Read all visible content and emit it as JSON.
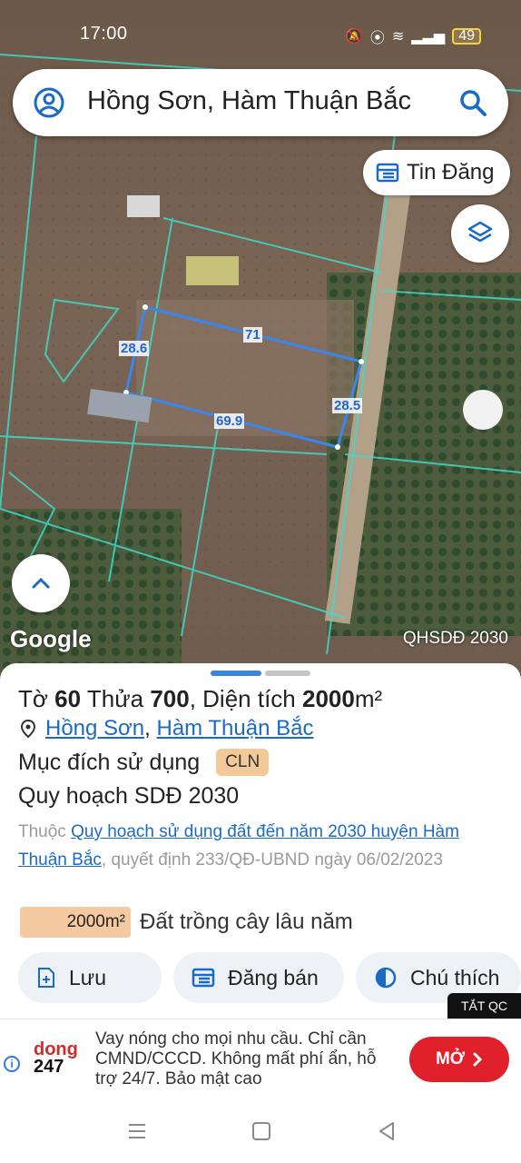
{
  "status_bar": {
    "time": "17:00",
    "battery": "49"
  },
  "search": {
    "query": "Hồng Sơn, Hàm Thuận Bắc"
  },
  "map": {
    "tin_dang_label": "Tin Đăng",
    "google_label": "Google",
    "plan_badge": "QHSDĐ 2030",
    "dimensions": {
      "top": "71",
      "left": "28.6",
      "right": "28.5",
      "bottom": "69.9"
    }
  },
  "parcel": {
    "sheet_prefix": "Tờ",
    "sheet_no": "60",
    "plot_prefix": "Thửa",
    "plot_no": "700",
    "area_prefix": ", Diện tích",
    "area_value": "2000",
    "area_unit": "m²",
    "ward": "Hồng Sơn",
    "district": "Hàm Thuận Bắc",
    "purpose_label": "Mục đích sử dụng",
    "purpose_code": "CLN",
    "plan_title": "Quy hoạch SDĐ 2030",
    "plan_desc_prefix": "Thuộc",
    "plan_desc_link": "Quy hoạch sử dụng đất đến năm 2030 huyện Hàm Thuận Bắc",
    "plan_desc_suffix": ", quyết định 233/QĐ-UBND ngày 06/02/2023",
    "area_badge": "2000m²",
    "area_use": "Đất trồng cây lâu năm"
  },
  "actions": {
    "save": "Lưu",
    "sell": "Đăng bán",
    "legend": "Chú thích"
  },
  "ad": {
    "close_label": "TẮT QC",
    "logo_line1": "dong",
    "logo_line2": "247",
    "text": "Vay nóng cho mọi nhu cầu. Chỉ cần CMND/CCCD. Không mất phí ẩn, hỗ trợ 24/7. Bảo mật cao",
    "cta": "MỞ"
  },
  "colors": {
    "accent": "#1a6bc6",
    "parcel_outline": "#3a86f0",
    "cta": "#e0202a",
    "badge": "#f4c999"
  }
}
